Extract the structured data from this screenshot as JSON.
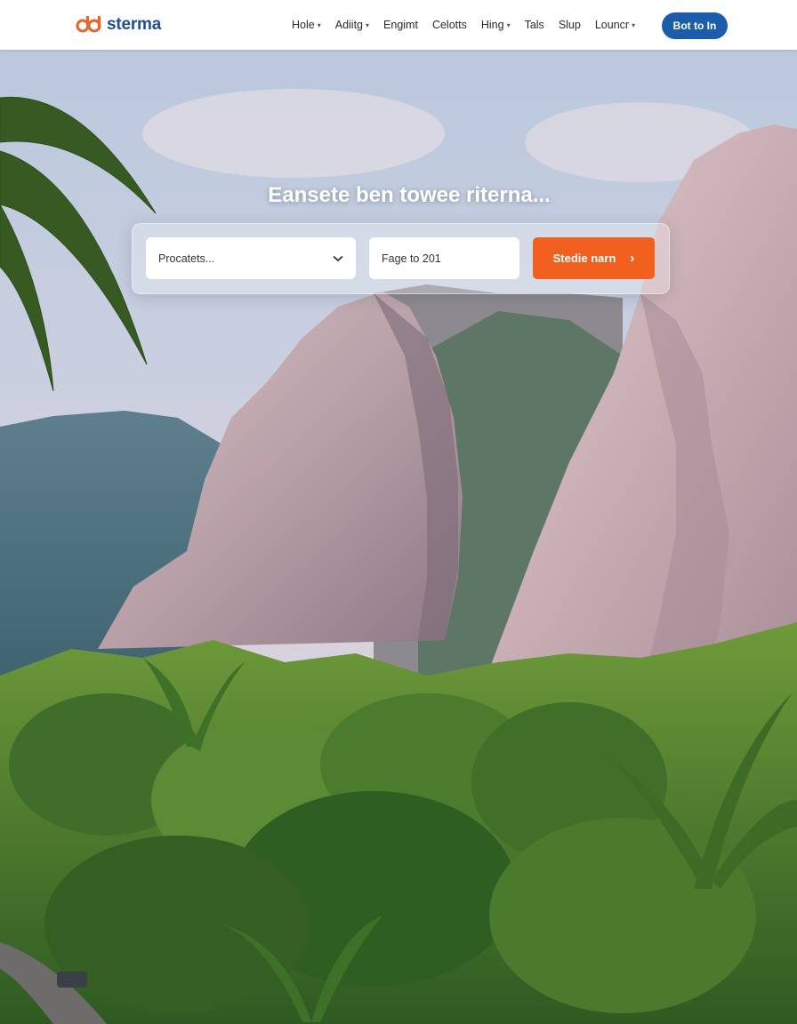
{
  "brand": {
    "name": "sterma",
    "logo_icon": "dual-loop-logo-icon"
  },
  "nav": {
    "items": [
      {
        "label": "Hole",
        "dropdown": true
      },
      {
        "label": "Adiitg",
        "dropdown": true
      },
      {
        "label": "Engimt",
        "dropdown": false
      },
      {
        "label": "Celotts",
        "dropdown": false
      },
      {
        "label": "Hing",
        "dropdown": true
      },
      {
        "label": "Tals",
        "dropdown": false
      },
      {
        "label": "Slup",
        "dropdown": false
      },
      {
        "label": "Louncr",
        "dropdown": true
      }
    ],
    "cta_label": "Bot to In"
  },
  "hero": {
    "headline": "Eansete ben towee riterna...",
    "search": {
      "select_value": "Procatets...",
      "date_value": "Fage to 201",
      "button_label": "Stedie narn",
      "button_icon": "chevron-right-icon"
    }
  },
  "colors": {
    "accent": "#f2601f",
    "primary": "#1b5cab",
    "brand_text": "#1f4f8c",
    "logo_orange": "#e8642a"
  }
}
